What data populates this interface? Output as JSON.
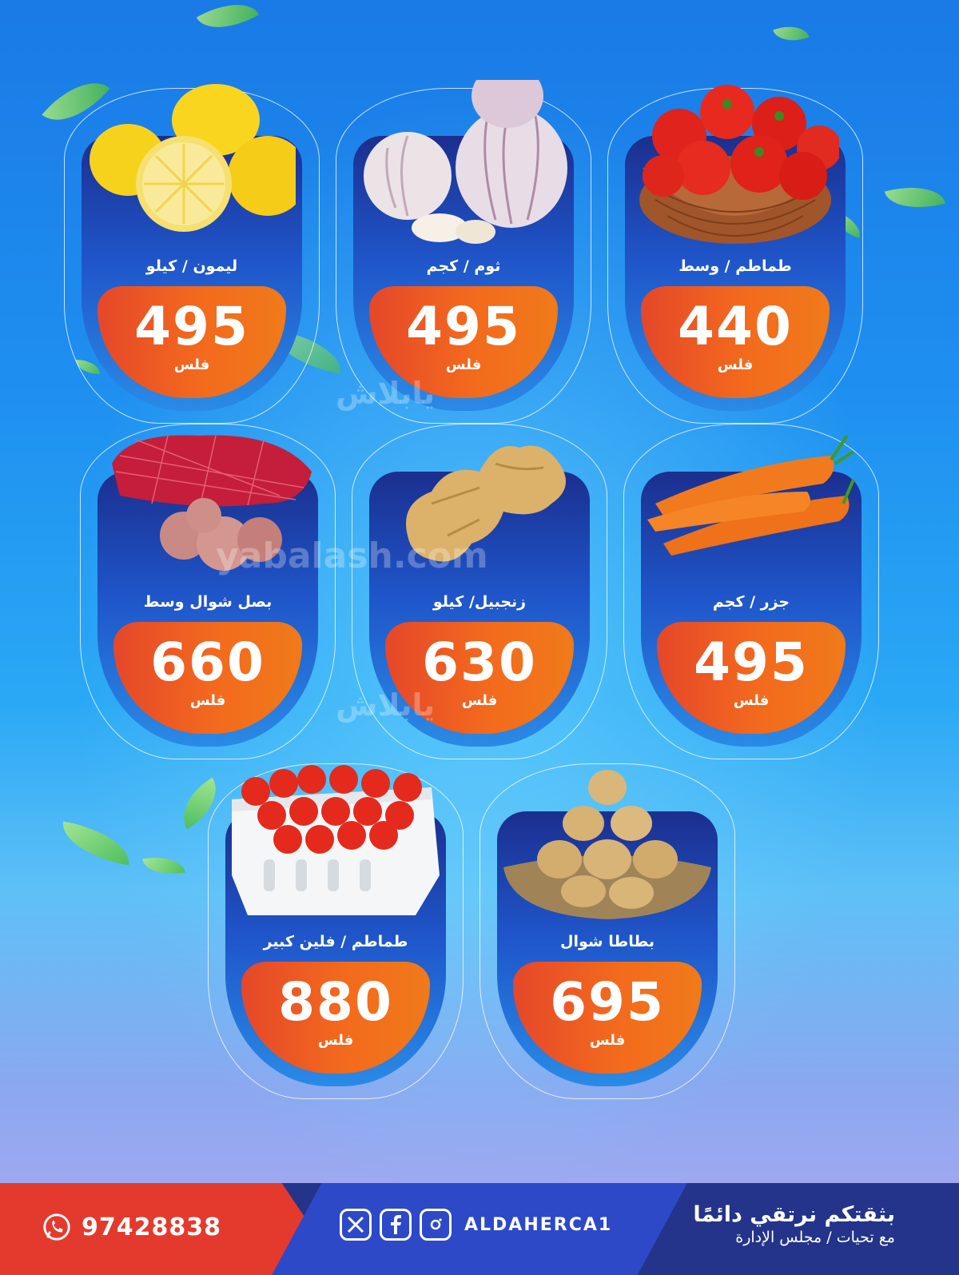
{
  "products": [
    {
      "name": "طماطم / وسط",
      "price": "440",
      "unit": "فلس",
      "image": "tomatoes-basket"
    },
    {
      "name": "ثوم / كجم",
      "price": "495",
      "unit": "فلس",
      "image": "garlic"
    },
    {
      "name": "ليمون / كيلو",
      "price": "495",
      "unit": "فلس",
      "image": "lemons"
    },
    {
      "name": "جزر / كجم",
      "price": "495",
      "unit": "فلس",
      "image": "carrots"
    },
    {
      "name": "زنجبيل/ كيلو",
      "price": "630",
      "unit": "فلس",
      "image": "ginger"
    },
    {
      "name": "بصل شوال وسط",
      "price": "660",
      "unit": "فلس",
      "image": "onion-sack"
    },
    {
      "name": "بطاطا شوال",
      "price": "695",
      "unit": "فلس",
      "image": "potatoes"
    },
    {
      "name": "طماطم / فلين كبير",
      "price": "880",
      "unit": "فلس",
      "image": "tomatoes-foam-box"
    }
  ],
  "watermarks": [
    "يابلاش",
    "yabalash.com",
    "يابلاش"
  ],
  "footer": {
    "phone": "97428838",
    "handle": "ALDAHERCA1",
    "slogan_line1": "بثقتكم نرتقي دائمًا",
    "slogan_line2": "مع تحيات / مجلس الإدارة"
  },
  "icons": [
    "whatsapp-icon",
    "x-icon",
    "facebook-icon",
    "instagram-icon"
  ]
}
